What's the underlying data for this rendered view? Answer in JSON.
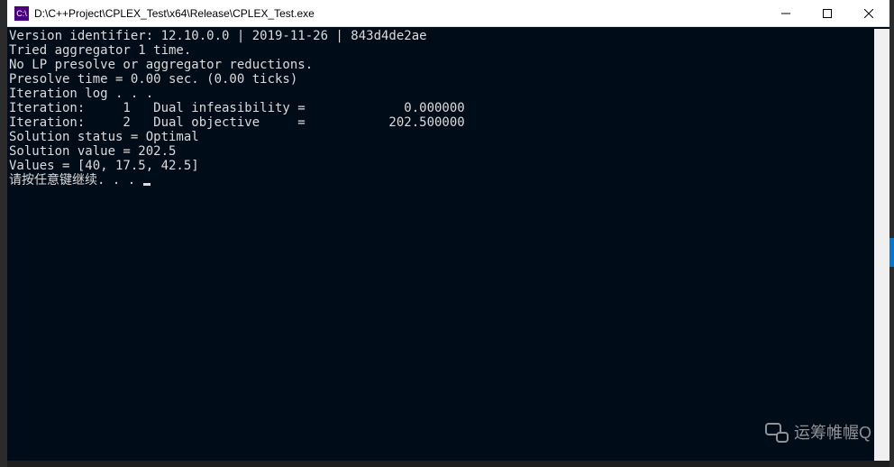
{
  "window": {
    "icon_text": "C:\\",
    "title": "D:\\C++Project\\CPLEX_Test\\x64\\Release\\CPLEX_Test.exe"
  },
  "console": {
    "lines": [
      "Version identifier: 12.10.0.0 | 2019-11-26 | 843d4de2ae",
      "Tried aggregator 1 time.",
      "No LP presolve or aggregator reductions.",
      "Presolve time = 0.00 sec. (0.00 ticks)",
      "",
      "Iteration log . . .",
      "Iteration:     1   Dual infeasibility =             0.000000",
      "Iteration:     2   Dual objective     =           202.500000",
      "Solution status = Optimal",
      "Solution value = 202.5",
      "Values = [40, 17.5, 42.5]",
      "请按任意键继续. . . "
    ]
  },
  "watermark": {
    "text": "运筹帷幄Q"
  }
}
